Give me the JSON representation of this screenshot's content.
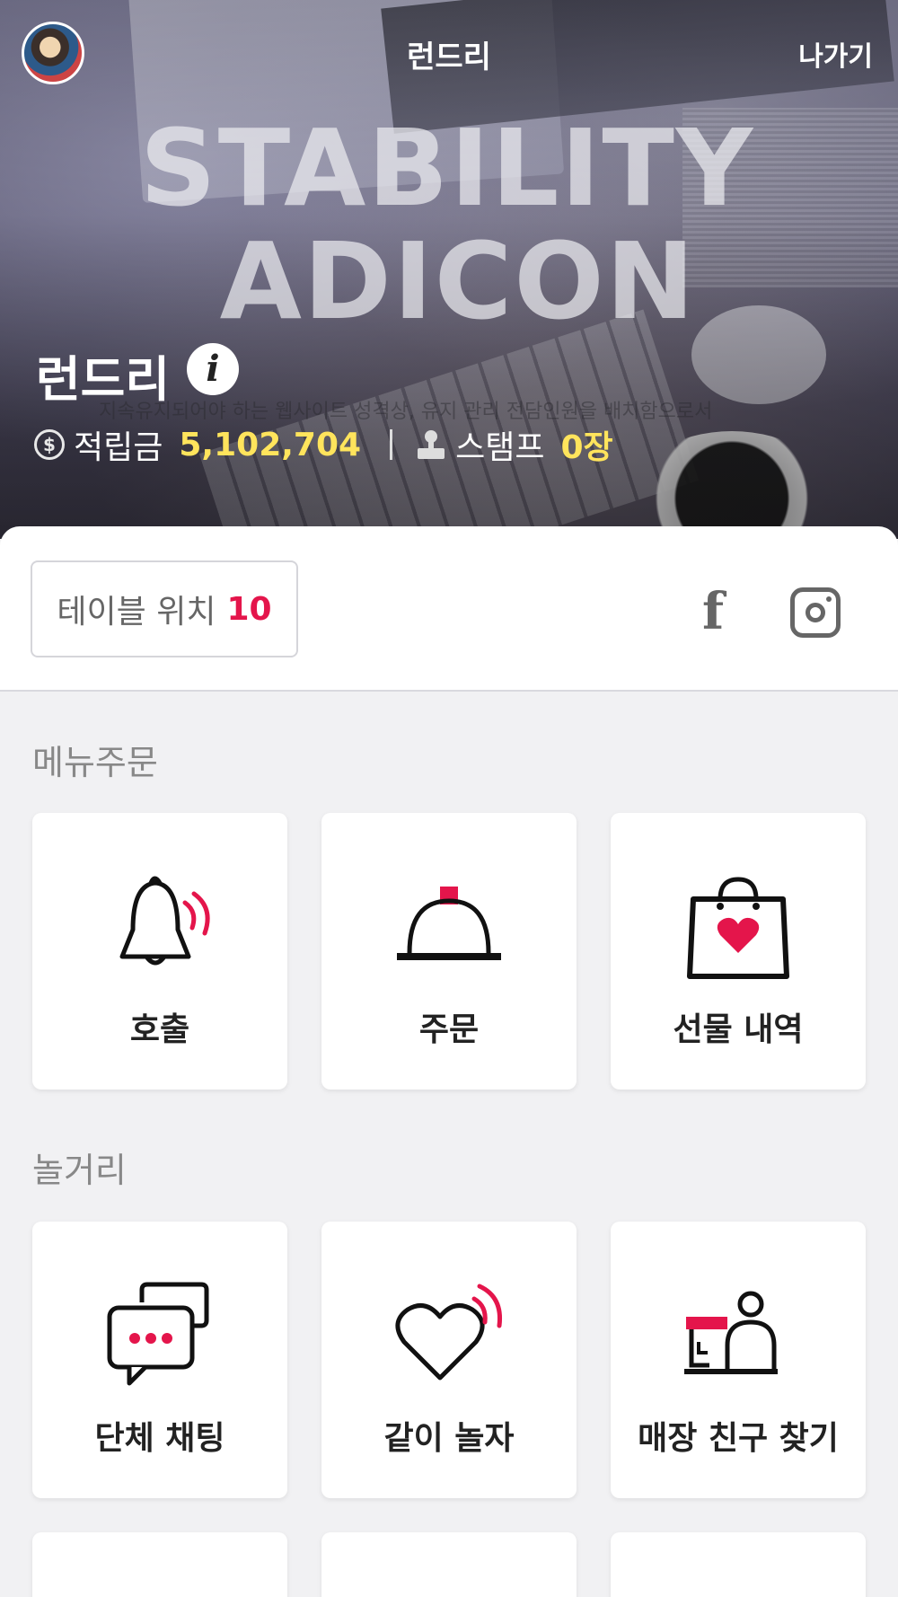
{
  "header": {
    "title": "런드리",
    "exit_label": "나가기"
  },
  "hero": {
    "watermark_line1": "STABILITY",
    "watermark_line2": "ADICON",
    "faint_text": "지속유지되어야 하는 웹사이트 성격상, 유지 관리 전담인원을 배치함으로서",
    "store_name": "런드리",
    "points_label": "적립금",
    "points_value": "5,102,704",
    "stamp_label": "스탬프",
    "stamp_value": "0장"
  },
  "table": {
    "label": "테이블 위치",
    "number": "10"
  },
  "social": {
    "facebook_glyph": "f",
    "icons": [
      "facebook-icon",
      "instagram-icon"
    ]
  },
  "sections": {
    "menu_order": {
      "title": "메뉴주문",
      "items": [
        {
          "label": "호출",
          "icon": "bell-icon"
        },
        {
          "label": "주문",
          "icon": "cloche-icon"
        },
        {
          "label": "선물 내역",
          "icon": "gift-bag-icon"
        }
      ]
    },
    "fun": {
      "title": "놀거리",
      "items": [
        {
          "label": "단체 채팅",
          "icon": "chat-icon"
        },
        {
          "label": "같이 놀자",
          "icon": "heart-signal-icon"
        },
        {
          "label": "매장 친구 찾기",
          "icon": "friend-finder-icon"
        }
      ]
    }
  },
  "colors": {
    "accent": "#e4154b",
    "highlight": "#ffe45c",
    "background": "#f1f1f3"
  }
}
